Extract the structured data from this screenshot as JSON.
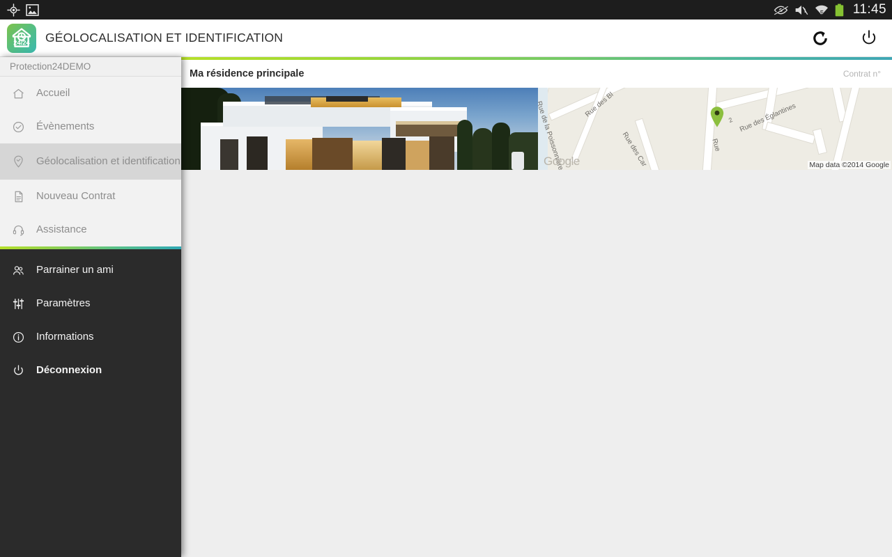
{
  "statusbar": {
    "left_icons": [
      "gps-crosshair-icon",
      "screenshot-image-icon"
    ],
    "right_icons": [
      "smart-stay-eye-icon",
      "sound-mute-icon",
      "wifi-icon",
      "battery-icon"
    ],
    "time": "11:45"
  },
  "actionbar": {
    "logo_name": "protection24-logo",
    "logo_text": "24/24",
    "title": "GÉOLOCALISATION ET IDENTIFICATION",
    "refresh_label": "refresh-icon",
    "power_label": "power-icon"
  },
  "drawer": {
    "account": "Protection24DEMO",
    "top_items": [
      {
        "label": "Accueil",
        "icon": "home-icon",
        "selected": false
      },
      {
        "label": "Évènements",
        "icon": "check-circle-icon",
        "selected": false
      },
      {
        "label": "Géolocalisation et identification",
        "icon": "map-pin-icon",
        "selected": true
      },
      {
        "label": "Nouveau Contrat",
        "icon": "document-icon",
        "selected": false
      },
      {
        "label": "Assistance",
        "icon": "headset-icon",
        "selected": false
      }
    ],
    "bottom_items": [
      {
        "label": "Parrainer un ami",
        "icon": "people-icon",
        "bold": false
      },
      {
        "label": "Paramètres",
        "icon": "sliders-icon",
        "bold": false
      },
      {
        "label": "Informations",
        "icon": "info-circle-icon",
        "bold": false
      },
      {
        "label": "Déconnexion",
        "icon": "power-icon",
        "bold": true
      }
    ]
  },
  "content": {
    "card": {
      "title": "Ma résidence principale",
      "contract": "Contrat n°",
      "photo_alt": "modern-house-photo",
      "map": {
        "street_labels": [
          "Rue de la Poissonnière",
          "Rue des Bl",
          "Rue des Car",
          "Rue",
          "Rue des Églantines",
          "2"
        ],
        "watermark": "Google",
        "attribution": "Map data ©2014 Google",
        "marker": "green-location-marker"
      }
    }
  },
  "colors": {
    "accent_green": "#b6e02a",
    "accent_teal": "#3fa7b5",
    "drawer_dark": "#2b2b2b",
    "selected_row": "#d6d6d6",
    "content_bg": "#eeeeee",
    "marker_green": "#8bc34a"
  }
}
